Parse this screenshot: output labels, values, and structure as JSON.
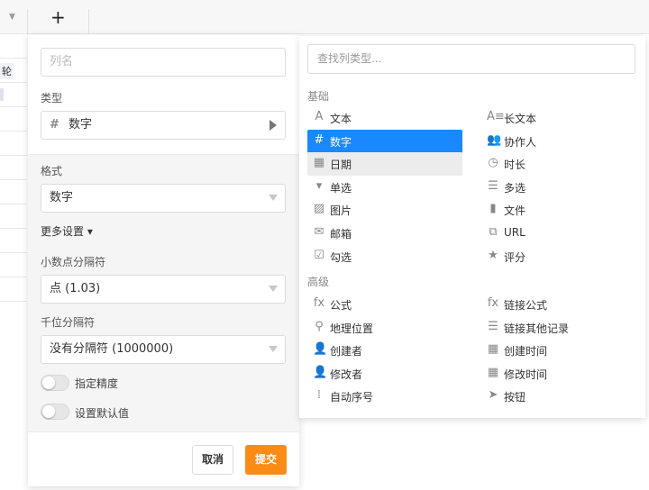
{
  "grid": {
    "add_symbol": "+",
    "cell_tag": "轮"
  },
  "form": {
    "name_placeholder": "列名",
    "type_label": "类型",
    "type_value": "数字",
    "format_label": "格式",
    "format_value": "数字",
    "more_settings": "更多设置 ▾",
    "decimal_label": "小数点分隔符",
    "decimal_value": "点 (1.03)",
    "thousand_label": "千位分隔符",
    "thousand_value": "没有分隔符 (1000000)",
    "precision_label": "指定精度",
    "default_label": "设置默认值",
    "cancel": "取消",
    "submit": "提交"
  },
  "types": {
    "search_placeholder": "查找列类型...",
    "basic_title": "基础",
    "advanced_title": "高级",
    "basic": [
      {
        "label": "文本",
        "icon": "text-icon",
        "glyph": "A"
      },
      {
        "label": "长文本",
        "icon": "long-text-icon",
        "glyph": "A≡"
      },
      {
        "label": "数字",
        "icon": "number-icon",
        "glyph": "#"
      },
      {
        "label": "协作人",
        "icon": "collaborator-icon",
        "glyph": "👥"
      },
      {
        "label": "日期",
        "icon": "date-icon",
        "glyph": "▦"
      },
      {
        "label": "时长",
        "icon": "duration-icon",
        "glyph": "◷"
      },
      {
        "label": "单选",
        "icon": "single-select-icon",
        "glyph": "▾"
      },
      {
        "label": "多选",
        "icon": "multi-select-icon",
        "glyph": "☰"
      },
      {
        "label": "图片",
        "icon": "image-icon",
        "glyph": "▨"
      },
      {
        "label": "文件",
        "icon": "file-icon",
        "glyph": "▮"
      },
      {
        "label": "邮箱",
        "icon": "email-icon",
        "glyph": "✉"
      },
      {
        "label": "URL",
        "icon": "url-icon",
        "glyph": "⧉"
      },
      {
        "label": "勾选",
        "icon": "checkbox-icon",
        "glyph": "☑"
      },
      {
        "label": "评分",
        "icon": "rating-icon",
        "glyph": "★"
      }
    ],
    "advanced": [
      {
        "label": "公式",
        "icon": "formula-icon",
        "glyph": "fx"
      },
      {
        "label": "链接公式",
        "icon": "link-formula-icon",
        "glyph": "fx"
      },
      {
        "label": "地理位置",
        "icon": "location-icon",
        "glyph": "⚲"
      },
      {
        "label": "链接其他记录",
        "icon": "link-record-icon",
        "glyph": "☰"
      },
      {
        "label": "创建者",
        "icon": "creator-icon",
        "glyph": "👤"
      },
      {
        "label": "创建时间",
        "icon": "created-time-icon",
        "glyph": "▦"
      },
      {
        "label": "修改者",
        "icon": "modifier-icon",
        "glyph": "👤"
      },
      {
        "label": "修改时间",
        "icon": "modified-time-icon",
        "glyph": "▦"
      },
      {
        "label": "自动序号",
        "icon": "auto-number-icon",
        "glyph": "⁞"
      },
      {
        "label": "按钮",
        "icon": "button-icon",
        "glyph": "➤"
      }
    ],
    "selected": "数字",
    "hovered": "日期",
    "selected_color": "#1a88ff",
    "submit_color": "#fa8c16"
  }
}
